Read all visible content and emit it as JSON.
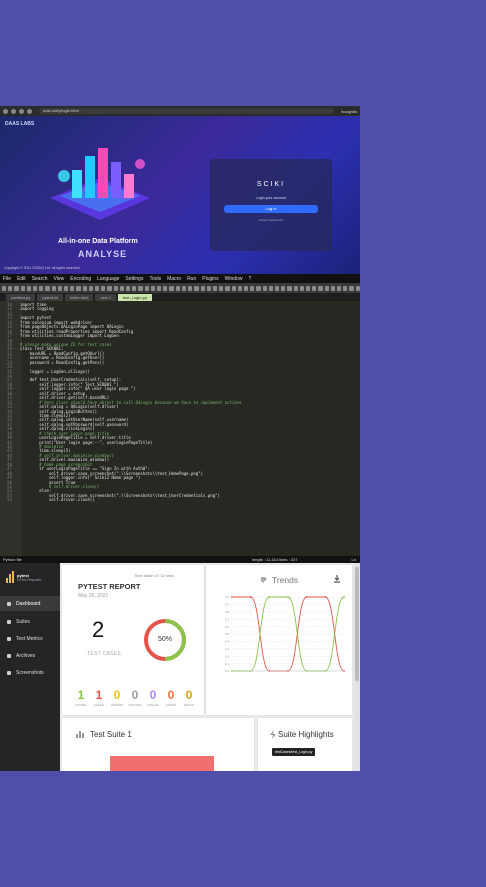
{
  "browser": {
    "url": "sciki.unify/login.html",
    "profile": "Incognito",
    "brand": "DAAS LABS",
    "hero_title": "All-in-one Data Platform",
    "hero_subtitle": "ANALYSE",
    "login_logo": "SCIKI",
    "login_hint": "Login your account",
    "login_button": "Log in",
    "forgot": "Forgot Password?",
    "copyright": "Copyright © 2021 SCIKIQ Ltd. all rights reserved"
  },
  "editor": {
    "menu": [
      "File",
      "Edit",
      "Search",
      "View",
      "Encoding",
      "Language",
      "Settings",
      "Tools",
      "Macro",
      "Run",
      "Plugins",
      "Window",
      "?"
    ],
    "tabs": [
      {
        "label": "conftest.py",
        "active": false
      },
      {
        "label": "pytest.ini",
        "active": false
      },
      {
        "label": "index.html",
        "active": false
      },
      {
        "label": "new 1",
        "active": false
      },
      {
        "label": "test_Login.py",
        "active": true
      }
    ],
    "lines": [
      {
        "n": "10",
        "t": "import time",
        "c": ""
      },
      {
        "n": "11",
        "t": "import logging",
        "c": ""
      },
      {
        "n": "12",
        "t": "",
        "c": ""
      },
      {
        "n": "13",
        "t": "import pytest",
        "c": ""
      },
      {
        "n": "14",
        "t": "from selenium import webdriver",
        "c": ""
      },
      {
        "n": "15",
        "t": "from pageObjects.QALoginPage import QALogin",
        "c": ""
      },
      {
        "n": "16",
        "t": "from utilities.readProperties import ReadConfig",
        "c": ""
      },
      {
        "n": "17",
        "t": "from utilities.customLogger import LogGen",
        "c": ""
      },
      {
        "n": "18",
        "t": "",
        "c": ""
      },
      {
        "n": "19",
        "t": "# please make unique ID for test cases",
        "c": "cm"
      },
      {
        "n": "20",
        "t": "class Test_SCK001:",
        "c": ""
      },
      {
        "n": "21",
        "t": "    baseURL = ReadConfig.getQAurl()",
        "c": ""
      },
      {
        "n": "22",
        "t": "    username = ReadConfig.getUser()",
        "c": ""
      },
      {
        "n": "23",
        "t": "    password = ReadConfig.getPass()",
        "c": ""
      },
      {
        "n": "24",
        "t": "",
        "c": ""
      },
      {
        "n": "25",
        "t": "    logger = LogGen.allLogs()",
        "c": ""
      },
      {
        "n": "26",
        "t": "",
        "c": ""
      },
      {
        "n": "27",
        "t": "    def test_UserCredentials(self, setup):",
        "c": ""
      },
      {
        "n": "28",
        "t": "        self.logger.info(\" Test_SCK001 \")",
        "c": ""
      },
      {
        "n": "29",
        "t": "        self.logger.info(\" QA user login page \")",
        "c": ""
      },
      {
        "n": "30",
        "t": "        self.driver = setup",
        "c": ""
      },
      {
        "n": "31",
        "t": "        self.driver.get(self.baseURL)",
        "c": ""
      },
      {
        "n": "32",
        "t": "        # here class should have object to call QALogin because we have to implement actions",
        "c": "cm"
      },
      {
        "n": "33",
        "t": "        self.qalog = QALogin(self.driver)",
        "c": ""
      },
      {
        "n": "34",
        "t": "        self.qalog.LoginButton()",
        "c": ""
      },
      {
        "n": "35",
        "t": "        time.sleep(2)",
        "c": ""
      },
      {
        "n": "36",
        "t": "        self.qalog.setUserName(self.username)",
        "c": ""
      },
      {
        "n": "37",
        "t": "        self.qalog.setPassword(self.password)",
        "c": ""
      },
      {
        "n": "38",
        "t": "        self.qalog.clickLogin()",
        "c": ""
      },
      {
        "n": "39",
        "t": "        # check user login page title",
        "c": "cm"
      },
      {
        "n": "40",
        "t": "        userLoginPageTitle = self.driver.title",
        "c": ""
      },
      {
        "n": "41",
        "t": "        print(\"User login page:--\", userLoginPageTitle)",
        "c": ""
      },
      {
        "n": "42",
        "t": "        # maximize",
        "c": "cm"
      },
      {
        "n": "43",
        "t": "        time.sleep(5)",
        "c": ""
      },
      {
        "n": "44",
        "t": "        # self.driver.maximize_window()",
        "c": "cm"
      },
      {
        "n": "45",
        "t": "        self.driver.maximize_window()",
        "c": ""
      },
      {
        "n": "46",
        "t": "        # home page screenshot",
        "c": "cm"
      },
      {
        "n": "47",
        "t": "        if userLoginPageTitle == \"Sign In with Auth0\":",
        "c": ""
      },
      {
        "n": "48",
        "t": "            self.driver.save_screenshot(\".\\\\Screenshots\\\\test_HomePage.png\")",
        "c": ""
      },
      {
        "n": "49",
        "t": "            self.logger.info(\" Sciki2 Home page \")",
        "c": ""
      },
      {
        "n": "50",
        "t": "            assert True",
        "c": ""
      },
      {
        "n": "51",
        "t": "            # self.driver.close()",
        "c": "cm"
      },
      {
        "n": "52",
        "t": "        else:",
        "c": ""
      },
      {
        "n": "53",
        "t": "            self.driver.save_screenshot(\".\\\\Screenshots\\\\test_UserCredentials.png\")",
        "c": ""
      },
      {
        "n": "54",
        "t": "            self.driver.close()",
        "c": ""
      }
    ],
    "status_left": "Python file",
    "status_mid": "length : 11,314    lines : 227",
    "status_right": "Ln"
  },
  "report": {
    "logo_title": "pytest",
    "logo_subtitle": "HTML Reporter",
    "nav": [
      {
        "label": "Dashboard",
        "active": true
      },
      {
        "label": "Suites",
        "active": false
      },
      {
        "label": "Test Metrics",
        "active": false
      },
      {
        "label": "Archives",
        "active": false
      },
      {
        "label": "Screenshots",
        "active": false
      }
    ],
    "summary": {
      "title": "PYTEST REPORT",
      "date": "May 26, 2021",
      "timer": "Time taken 47.11 secs",
      "count": "2",
      "count_label": "TEST CASES",
      "percent": "50%",
      "pass_fraction": 0.5,
      "stats": [
        {
          "n": "1",
          "l": "PASSED",
          "color": "#8bc34a"
        },
        {
          "n": "1",
          "l": "FAILED",
          "color": "#e5534b"
        },
        {
          "n": "0",
          "l": "SKIPPED",
          "color": "#f0c419"
        },
        {
          "n": "0",
          "l": "XPASSED",
          "color": "#9e9e9e"
        },
        {
          "n": "0",
          "l": "XFAILED",
          "color": "#b388ff"
        },
        {
          "n": "0",
          "l": "ERROR",
          "color": "#ff7043"
        },
        {
          "n": "0",
          "l": "RERUN",
          "color": "#d4a017"
        }
      ]
    },
    "trends": {
      "title": "Trends"
    },
    "suite": {
      "title": "Test Suite 1"
    },
    "highlights": {
      "title": "Suite Highlights",
      "tooltip": "testCases/test_Login.py"
    }
  },
  "chart_data": {
    "type": "line",
    "title": "Trends",
    "y_ticks": [
      "1.0",
      "0.9",
      "0.8",
      "0.7",
      "0.6",
      "0.5",
      "0.4",
      "0.3",
      "0.2",
      "0.1",
      "0.0"
    ],
    "ylim": [
      0,
      1
    ],
    "grid": true,
    "series": [
      {
        "color": "#e5534b",
        "values": [
          1,
          1,
          0,
          0,
          1,
          1,
          0
        ]
      },
      {
        "color": "#8bc34a",
        "values": [
          0,
          0,
          1,
          1,
          0,
          0,
          1
        ]
      }
    ]
  }
}
